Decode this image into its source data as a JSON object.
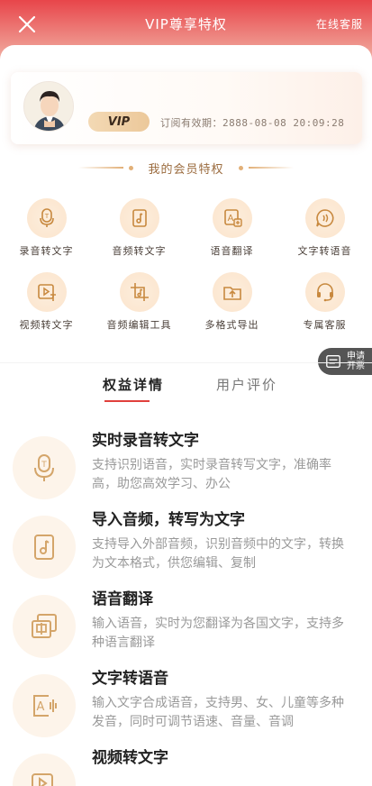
{
  "header": {
    "title": "VIP尊享特权",
    "service_link": "在线客服"
  },
  "user_card": {
    "vip_badge": "VIP",
    "expiry_label": "订阅有效期：",
    "expiry_date": "2888-08-08 20:09:28"
  },
  "section_title": "我的会员特权",
  "privileges": [
    {
      "label": "录音转文字",
      "icon": "mic-icon"
    },
    {
      "label": "音频转文字",
      "icon": "music-file-icon"
    },
    {
      "label": "语音翻译",
      "icon": "translate-icon"
    },
    {
      "label": "文字转语音",
      "icon": "speech-bubble-icon"
    },
    {
      "label": "视频转文字",
      "icon": "video-text-icon"
    },
    {
      "label": "音频编辑工具",
      "icon": "audio-edit-icon"
    },
    {
      "label": "多格式导出",
      "icon": "export-icon"
    },
    {
      "label": "专属客服",
      "icon": "headset-icon"
    }
  ],
  "invoice_button": {
    "line1": "申请",
    "line2": "开票"
  },
  "tabs": {
    "active": "权益详情",
    "inactive": "用户评价"
  },
  "benefits": [
    {
      "title": "实时录音转文字",
      "desc": "支持识别语音，实时录音转写文字，准确率高，助您高效学习、办公",
      "icon": "mic-icon"
    },
    {
      "title": "导入音频，转写为文字",
      "desc": "支持导入外部音频，识别音频中的文字，转换为文本格式，供您编辑、复制",
      "icon": "music-file-icon"
    },
    {
      "title": "语音翻译",
      "desc": "输入语音，实时为您翻译为各国文字，支持多种语言翻译",
      "icon": "translate-icon"
    },
    {
      "title": "文字转语音",
      "desc": "输入文字合成语音，支持男、女、儿童等多种发音，同时可调节语速、音量、音调",
      "icon": "text-to-speech-icon"
    },
    {
      "title": "视频转文字",
      "desc": "",
      "icon": "video-text-icon"
    }
  ],
  "colors": {
    "brand_red": "#e8454a",
    "gold": "#d4a56a",
    "icon_bg": "#fdeedd"
  }
}
